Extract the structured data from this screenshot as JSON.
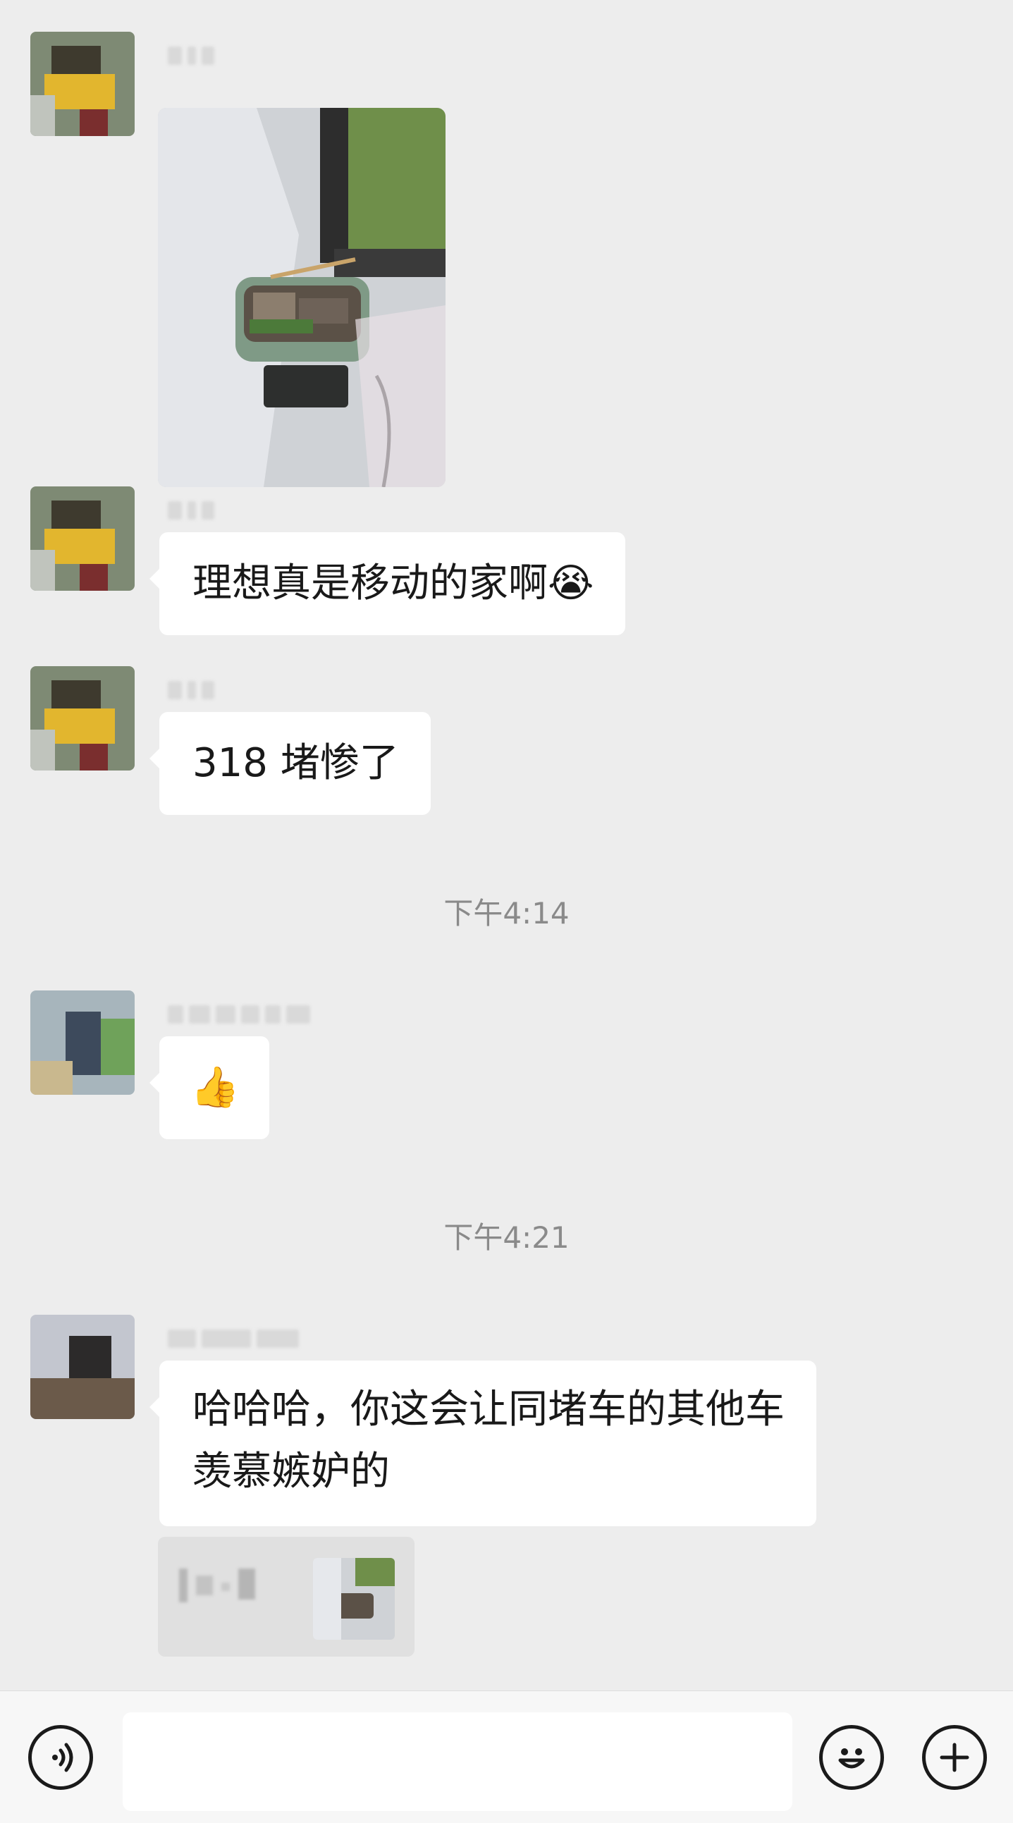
{
  "theme": {
    "background": "#ededed",
    "bubble": "#ffffff",
    "timestamp_color": "#8a8a8a"
  },
  "messages": [
    {
      "sender_icon": "blurred-avatar",
      "type": "image"
    },
    {
      "text": "理想真是移动的家啊",
      "emoji": "😭"
    },
    {
      "text": "318 堵惨了"
    },
    {
      "emoji": "👍"
    },
    {
      "text_line1": "哈哈哈，你这会让同堵车的其他车",
      "text_line2": "羡慕嫉妒的"
    }
  ],
  "timestamps": [
    "下午4:14",
    "下午4:21"
  ],
  "input_bar": {
    "placeholder": "",
    "voice_icon": "voice-icon",
    "emoji_icon": "smiley-icon",
    "plus_icon": "plus-icon"
  }
}
